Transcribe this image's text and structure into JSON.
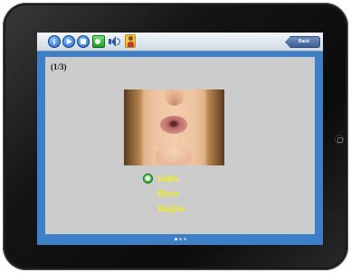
{
  "toolbar": {
    "back_label": "Back"
  },
  "lesson": {
    "counter": "(1/3)",
    "words": [
      "IoBo",
      "Bata",
      "Bajita"
    ]
  },
  "pager": {
    "total": 3,
    "active": 1
  },
  "colors": {
    "screen_bg": "#3d80c8",
    "content_bg": "#cccccc",
    "word_color": "#f2ec1e"
  }
}
